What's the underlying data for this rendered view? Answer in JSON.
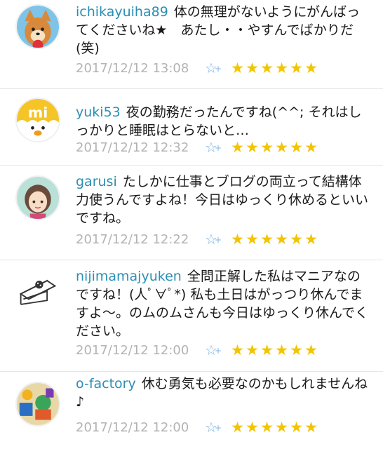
{
  "comments": [
    {
      "username": "ichikayuiha89",
      "text": "体の無理がないようにがんばってくださいね★　あたし・・やすんでばかりだ(笑)",
      "date": "2017/12/12 13:08",
      "star_count": 6,
      "avatar_icon": "shiba-dog-avatar-icon"
    },
    {
      "username": "yuki53",
      "text": "夜の勤務だったんですね(^^; それはしっかりと睡眠はとらないと…",
      "date": "2017/12/12 12:32",
      "star_count": 6,
      "avatar_icon": "mi-chick-avatar-icon"
    },
    {
      "username": "garusi",
      "text": "たしかに仕事とブログの両立って結構体力使うんですよね！今日はゆっくり休めるといいですね。",
      "date": "2017/12/12 12:22",
      "star_count": 6,
      "avatar_icon": "girl-avatar-icon"
    },
    {
      "username": "nijimamajyuken",
      "text": "全問正解した私はマニアなのですね！(人ﾟ∀ﾟ*) 私も土日はがっつり休んでますよ～。のムのムさんも今日はゆっくり休んでください。",
      "date": "2017/12/12 12:00",
      "star_count": 6,
      "avatar_icon": "cake-slice-avatar-icon"
    },
    {
      "username": "o-factory",
      "text": "休む勇気も必要なのかもしれませんね♪",
      "date": "2017/12/12 12:00",
      "star_count": 6,
      "avatar_icon": "toys-avatar-icon"
    }
  ],
  "add_star_glyph": "☆",
  "add_star_plus": "+",
  "star_glyph": "★",
  "colors": {
    "username": "#2a8fb4",
    "date": "#b3b3b3",
    "star": "#f3c400",
    "add_star": "#7fb4e6"
  }
}
